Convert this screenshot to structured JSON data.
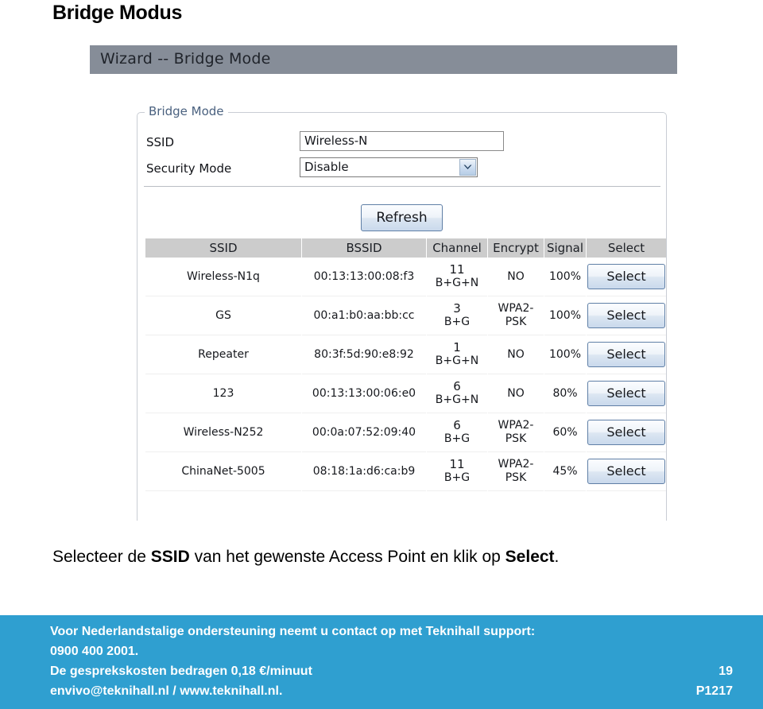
{
  "page": {
    "heading": "Bridge Modus"
  },
  "wizard": {
    "titlebar": "Wizard -- Bridge Mode",
    "panel_legend": "Bridge Mode",
    "fields": {
      "ssid_label": "SSID",
      "ssid_value": "Wireless-N",
      "ssid_placeholder": "Wireless-N",
      "security_label": "Security Mode",
      "security_value": "Disable",
      "security_options": [
        "Disable"
      ],
      "dropdown_icon": "chevron-down-icon"
    },
    "refresh_label": "Refresh",
    "table": {
      "columns": [
        "SSID",
        "BSSID",
        "Channel",
        "Encrypt",
        "Signal",
        "Select"
      ],
      "select_label": "Select",
      "rows": [
        {
          "ssid": "Wireless-N1q",
          "bssid": "00:13:13:00:08:f3",
          "channel": "11",
          "band": "B+G+N",
          "encrypt": "NO",
          "signal": "100%",
          "action": "Select"
        },
        {
          "ssid": "GS",
          "bssid": "00:a1:b0:aa:bb:cc",
          "channel": "3",
          "band": "B+G",
          "encrypt": "WPA2-PSK",
          "signal": "100%",
          "action": "Select"
        },
        {
          "ssid": "Repeater",
          "bssid": "80:3f:5d:90:e8:92",
          "channel": "1",
          "band": "B+G+N",
          "encrypt": "NO",
          "signal": "100%",
          "action": "Select"
        },
        {
          "ssid": "123",
          "bssid": "00:13:13:00:06:e0",
          "channel": "6",
          "band": "B+G+N",
          "encrypt": "NO",
          "signal": "80%",
          "action": "Select"
        },
        {
          "ssid": "Wireless-N252",
          "bssid": "00:0a:07:52:09:40",
          "channel": "6",
          "band": "B+G",
          "encrypt": "WPA2-PSK",
          "signal": "60%",
          "action": "Select"
        },
        {
          "ssid": "ChinaNet-5005",
          "bssid": "08:18:1a:d6:ca:b9",
          "channel": "11",
          "band": "B+G",
          "encrypt": "WPA2-PSK",
          "signal": "45%",
          "action": "Select"
        }
      ]
    }
  },
  "instructions": {
    "part1": "Selecteer de ",
    "bold1": "SSID",
    "part2": " van  het gewenste Access Point en klik op ",
    "bold2": "Select",
    "part3": "."
  },
  "footer": {
    "line1": "Voor Nederlandstalige ondersteuning neemt u contact op met Teknihall support:",
    "line2": "0900 400 2001.",
    "line3": "De gesprekskosten bedragen 0,18 €/minuut",
    "line4": "envivo@teknihall.nl / www.teknihall.nl.",
    "page_number": "19",
    "doc_code": "P1217"
  },
  "colors": {
    "footer_blue": "#2f9fd0",
    "titlebar_gray": "#868d98",
    "table_header_gray": "#cccccc",
    "legend_blue": "#4a617f"
  }
}
